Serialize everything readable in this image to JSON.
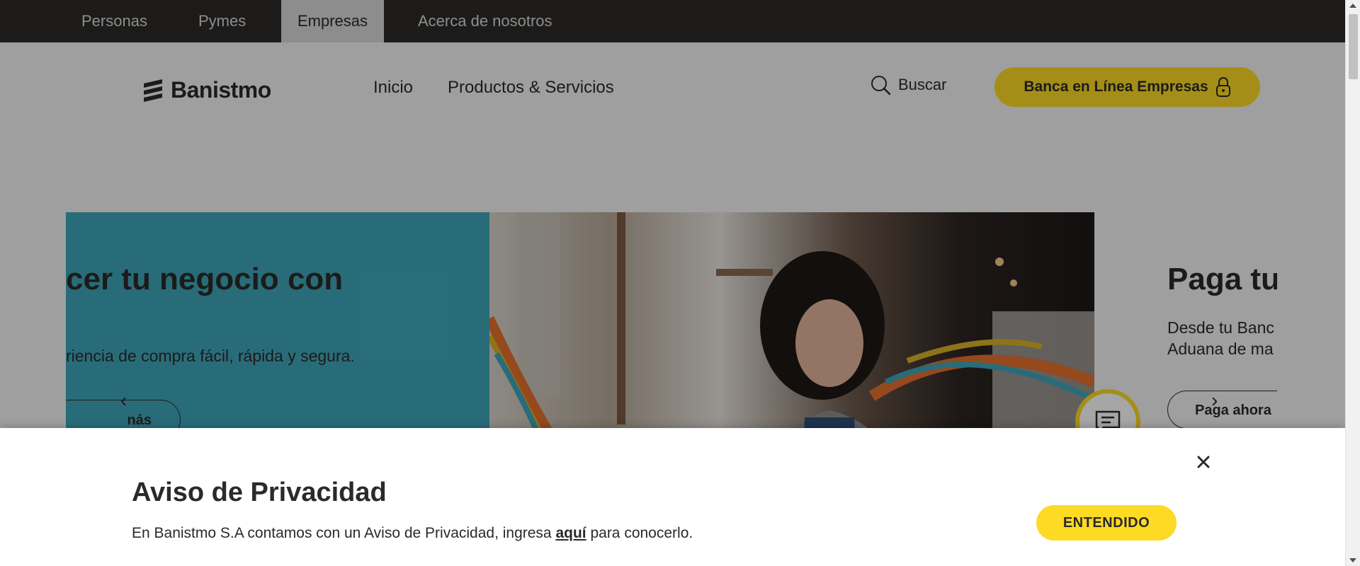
{
  "topbar": {
    "tabs": [
      {
        "label": "Personas",
        "active": false
      },
      {
        "label": "Pymes",
        "active": false
      },
      {
        "label": "Empresas",
        "active": true
      },
      {
        "label": "Acerca de nosotros",
        "active": false
      }
    ]
  },
  "header": {
    "logo_text": "Banistmo",
    "nav": [
      {
        "label": "Inicio"
      },
      {
        "label": "Productos & Servicios"
      }
    ],
    "search_label": "Buscar",
    "cta_label": "Banca en Línea Empresas"
  },
  "hero": {
    "slide_current": {
      "title": "cer tu negocio con",
      "subtitle": "riencia de compra fácil, rápida y segura.",
      "button_label": "nás"
    },
    "slide_next": {
      "title": "Paga tu",
      "line1": "Desde tu Banc",
      "line2": "Aduana de ma",
      "button_label": "Paga ahora"
    }
  },
  "privacy": {
    "title": "Aviso de Privacidad",
    "text_before": "En Banistmo S.A contamos con un Aviso de Privacidad, ingresa ",
    "link_text": "aquí",
    "text_after": " para conocerlo.",
    "ok_label": "ENTENDIDO"
  },
  "colors": {
    "brand_yellow": "#fdda24",
    "dark": "#2c2a29",
    "hero_blue": "#3fa6bb"
  }
}
